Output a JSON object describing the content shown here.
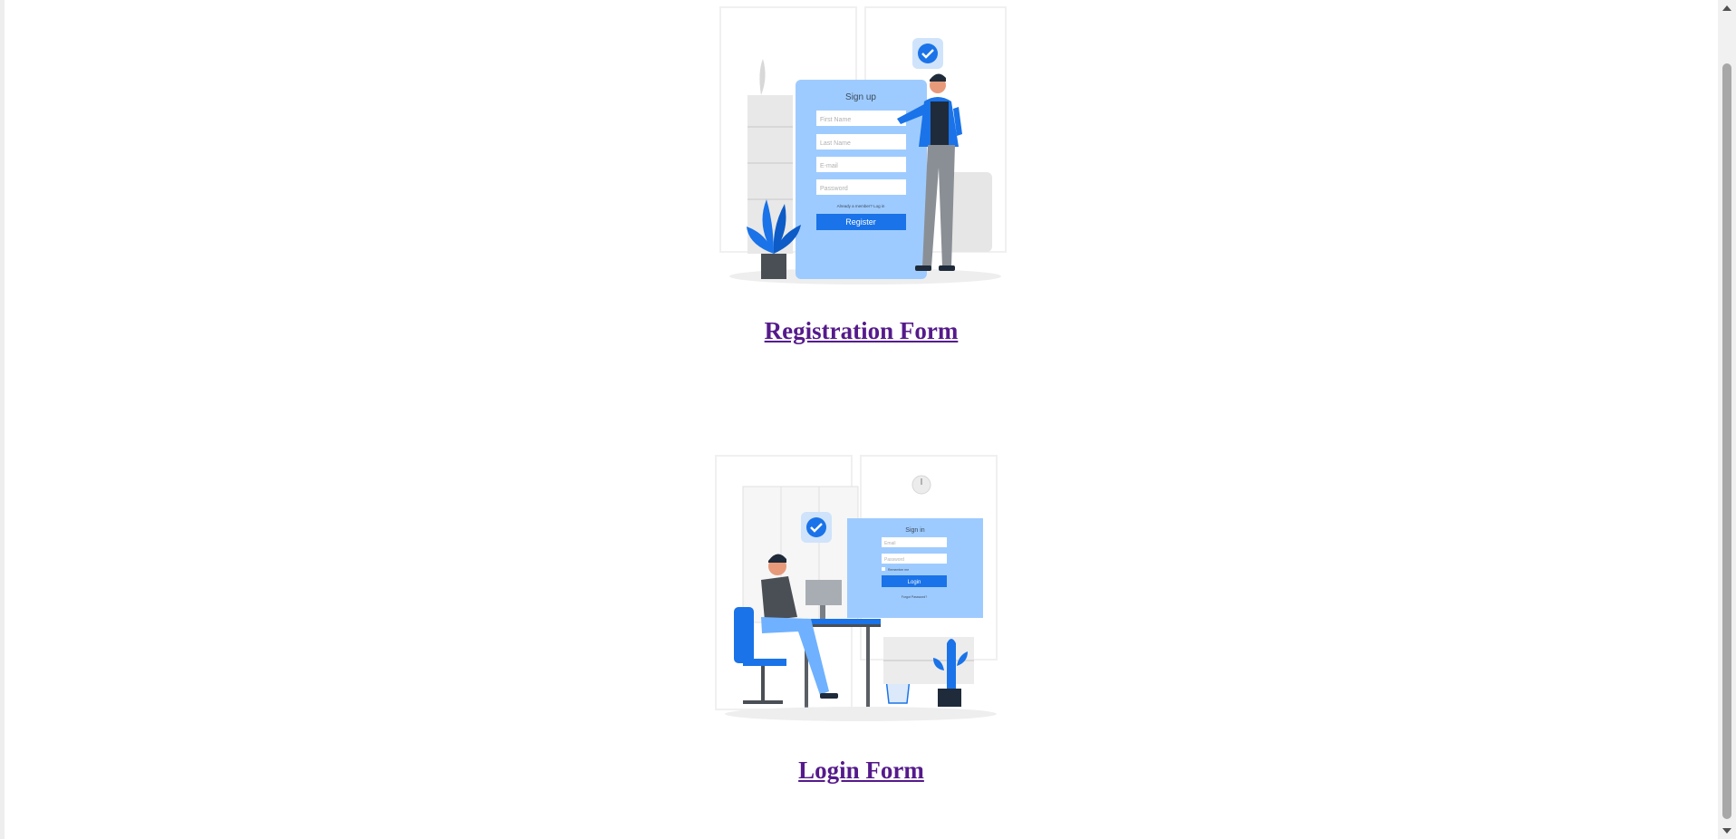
{
  "cards": [
    {
      "link": "Registration Form",
      "illustration": {
        "panel_title": "Sign up",
        "fields": [
          "First Name",
          "Last Name",
          "E-mail",
          "Password"
        ],
        "note": "Already a member? Log in",
        "button": "Register",
        "accent": "#1a73e8",
        "panel_color": "#9ecbff"
      }
    },
    {
      "link": "Login Form",
      "illustration": {
        "panel_title": "Sign in",
        "fields": [
          "Email",
          "Password"
        ],
        "remember": "Remember me",
        "button": "Login",
        "footer": "Forgot Password?",
        "accent": "#1a73e8",
        "panel_color": "#9ecbff"
      }
    }
  ],
  "scrollbar": {
    "up_icon": "triangle-up-icon",
    "down_icon": "triangle-down-icon"
  }
}
